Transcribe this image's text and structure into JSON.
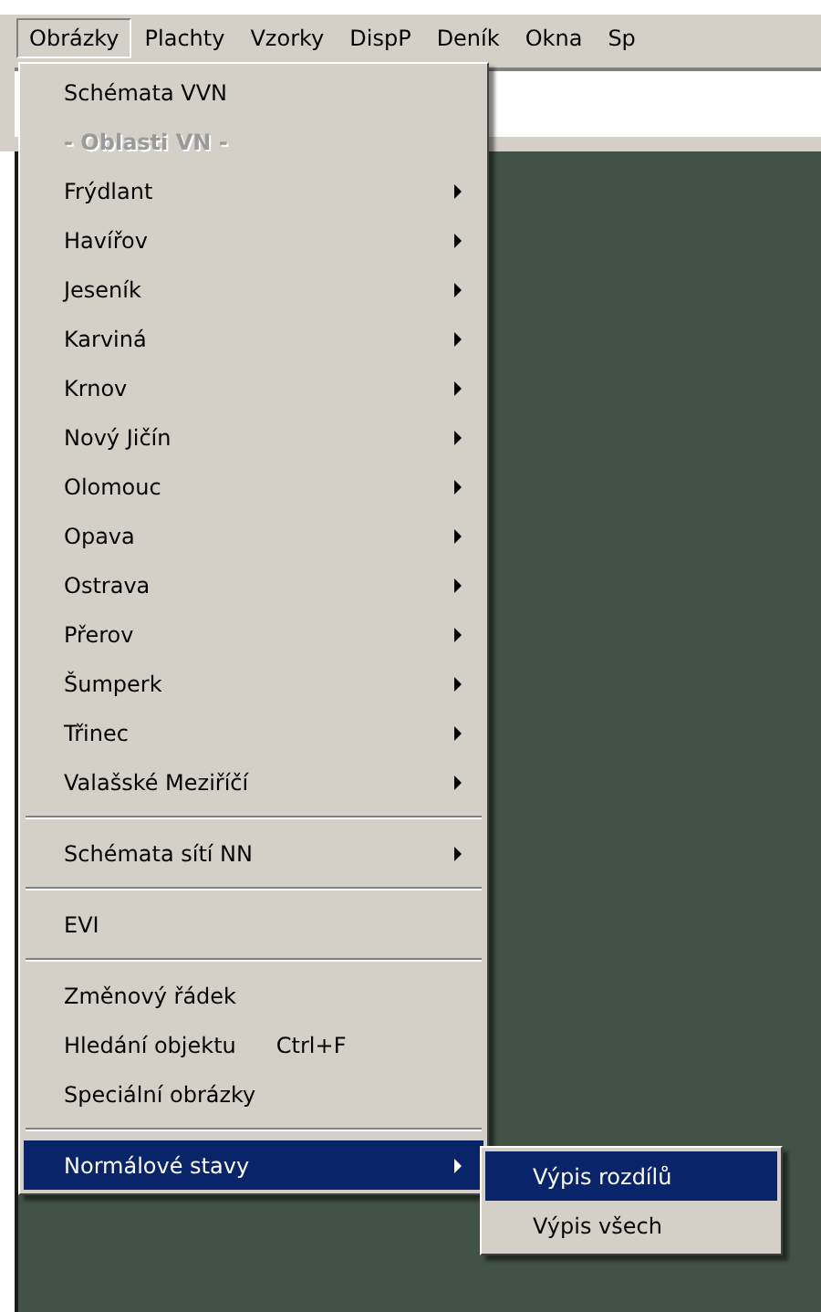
{
  "menubar": [
    {
      "label": "Obrázky",
      "selected": true
    },
    {
      "label": "Plachty",
      "selected": false
    },
    {
      "label": "Vzorky",
      "selected": false
    },
    {
      "label": "DispP",
      "selected": false
    },
    {
      "label": "Deník",
      "selected": false
    },
    {
      "label": "Okna",
      "selected": false
    },
    {
      "label": "Sp",
      "selected": false
    }
  ],
  "menu": [
    {
      "kind": "item",
      "label": "Schémata VVN",
      "submenu": false,
      "selected": false
    },
    {
      "kind": "header",
      "label": "- Oblasti VN -"
    },
    {
      "kind": "item",
      "label": "Frýdlant",
      "submenu": true,
      "selected": false
    },
    {
      "kind": "item",
      "label": "Havířov",
      "submenu": true,
      "selected": false
    },
    {
      "kind": "item",
      "label": "Jeseník",
      "submenu": true,
      "selected": false
    },
    {
      "kind": "item",
      "label": "Karviná",
      "submenu": true,
      "selected": false
    },
    {
      "kind": "item",
      "label": "Krnov",
      "submenu": true,
      "selected": false
    },
    {
      "kind": "item",
      "label": "Nový Jičín",
      "submenu": true,
      "selected": false
    },
    {
      "kind": "item",
      "label": "Olomouc",
      "submenu": true,
      "selected": false
    },
    {
      "kind": "item",
      "label": "Opava",
      "submenu": true,
      "selected": false
    },
    {
      "kind": "item",
      "label": "Ostrava",
      "submenu": true,
      "selected": false
    },
    {
      "kind": "item",
      "label": "Přerov",
      "submenu": true,
      "selected": false
    },
    {
      "kind": "item",
      "label": "Šumperk",
      "submenu": true,
      "selected": false
    },
    {
      "kind": "item",
      "label": "Třinec",
      "submenu": true,
      "selected": false
    },
    {
      "kind": "item",
      "label": "Valašské Meziříčí",
      "submenu": true,
      "selected": false
    },
    {
      "kind": "separator"
    },
    {
      "kind": "item",
      "label": "Schémata sítí NN",
      "submenu": true,
      "selected": false
    },
    {
      "kind": "separator"
    },
    {
      "kind": "item",
      "label": "EVI",
      "submenu": false,
      "selected": false
    },
    {
      "kind": "separator"
    },
    {
      "kind": "item",
      "label": "Změnový řádek",
      "submenu": false,
      "selected": false
    },
    {
      "kind": "item",
      "label": "Hledání objektu",
      "shortcut": "Ctrl+F",
      "submenu": false,
      "selected": false
    },
    {
      "kind": "item",
      "label": "Speciální obrázky",
      "submenu": false,
      "selected": false
    },
    {
      "kind": "separator"
    },
    {
      "kind": "item",
      "label": "Normálové stavy",
      "submenu": true,
      "selected": true,
      "children": [
        {
          "label": "Výpis rozdílů",
          "selected": true
        },
        {
          "label": "Výpis všech",
          "selected": false
        }
      ]
    }
  ]
}
